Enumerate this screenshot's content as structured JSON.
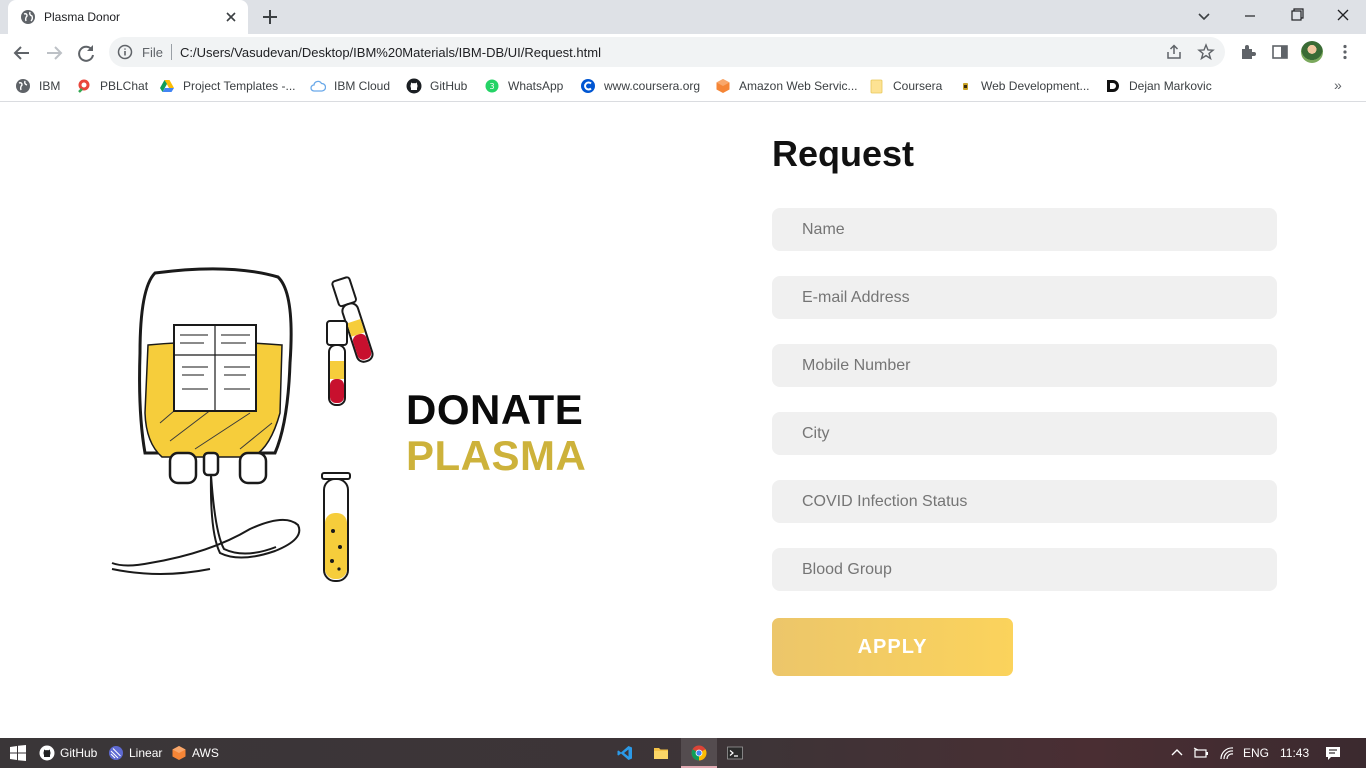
{
  "browser": {
    "tab": {
      "title": "Plasma Donor"
    },
    "address": {
      "scheme": "File",
      "url": "C:/Users/Vasudevan/Desktop/IBM%20Materials/IBM-DB/UI/Request.html"
    },
    "bookmarks": [
      {
        "label": "IBM",
        "icon": "globe-icon"
      },
      {
        "label": "PBLChat",
        "icon": "pblchat-icon"
      },
      {
        "label": "Project Templates -...",
        "icon": "google-drive-icon"
      },
      {
        "label": "IBM Cloud",
        "icon": "cloud-icon"
      },
      {
        "label": "GitHub",
        "icon": "github-icon"
      },
      {
        "label": "WhatsApp",
        "icon": "whatsapp-icon"
      },
      {
        "label": "www.coursera.org",
        "icon": "coursera-icon"
      },
      {
        "label": "Amazon Web Servic...",
        "icon": "aws-icon"
      },
      {
        "label": "Coursera",
        "icon": "folder-icon"
      },
      {
        "label": "Web Development...",
        "icon": "web-dev-icon"
      },
      {
        "label": "Dejan Markovic",
        "icon": "d-logo-icon"
      }
    ],
    "bookmarks_more": "»"
  },
  "page": {
    "logo_line1": "DONATE",
    "logo_line2": "PLASMA",
    "form": {
      "title": "Request",
      "fields": [
        {
          "placeholder": "Name"
        },
        {
          "placeholder": "E-mail Address"
        },
        {
          "placeholder": "Mobile Number"
        },
        {
          "placeholder": "City"
        },
        {
          "placeholder": "COVID Infection Status"
        },
        {
          "placeholder": "Blood Group"
        }
      ],
      "submit_label": "APPLY"
    }
  },
  "taskbar": {
    "pinned": [
      {
        "label": "GitHub",
        "icon": "github-icon"
      },
      {
        "label": "Linear",
        "icon": "linear-icon"
      },
      {
        "label": "AWS",
        "icon": "aws-icon"
      }
    ],
    "apps": [
      "vscode-icon",
      "file-explorer-icon",
      "chrome-icon",
      "terminal-icon"
    ],
    "language": "ENG",
    "time": "11:43"
  },
  "colors": {
    "accent_gold": "#cdb23b",
    "apply_gradient_start": "#ecc66a",
    "apply_gradient_end": "#fbd35c",
    "field_bg": "#f0f0f0"
  }
}
